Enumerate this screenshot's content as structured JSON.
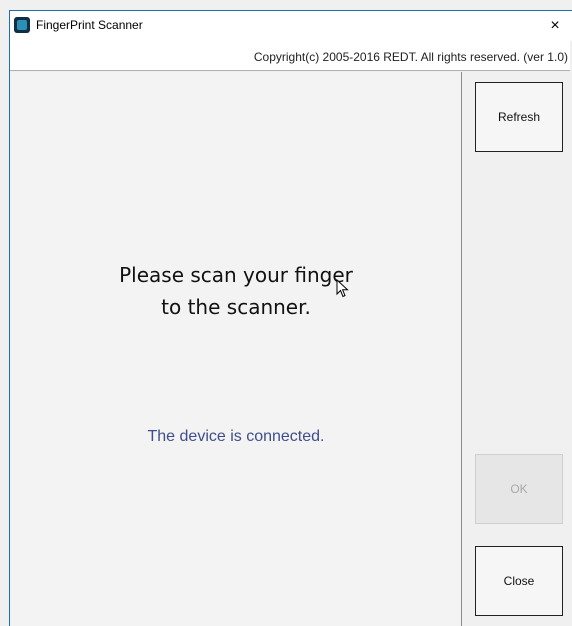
{
  "window": {
    "title": "FingerPrint Scanner",
    "close_symbol": "×",
    "copyright": "Copyright(c) 2005-2016 REDT. All rights reserved.  (ver 1.0)"
  },
  "main": {
    "prompt_line1": "Please scan your finger",
    "prompt_line2": "to the scanner.",
    "status": "The device is connected."
  },
  "buttons": {
    "refresh": "Refresh",
    "ok": "OK",
    "close": "Close"
  },
  "icons": {
    "app": "fingerprint-app-icon",
    "cursor": "mouse-pointer-icon"
  },
  "colors": {
    "status_text": "#3f4d8c",
    "window_accent": "#1f6fb0"
  }
}
